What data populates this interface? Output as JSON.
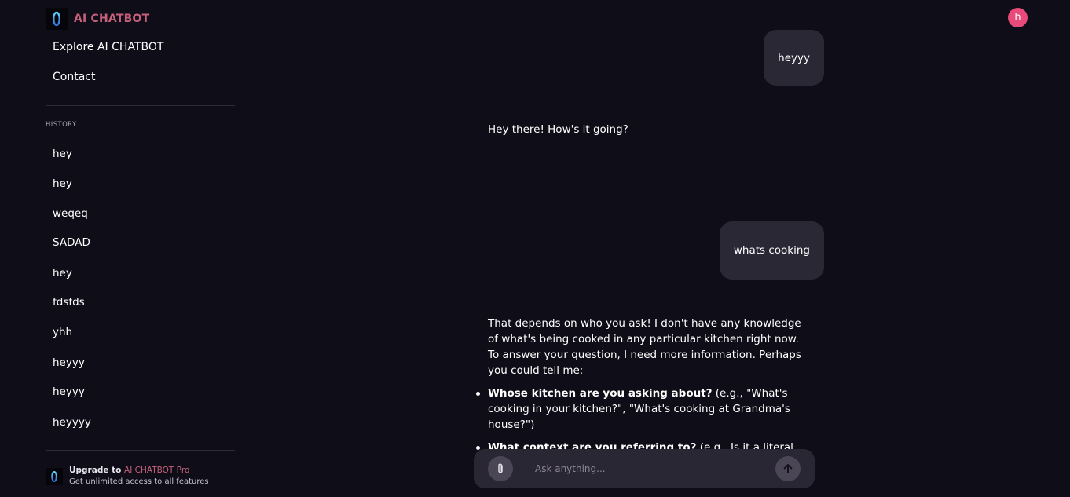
{
  "brand": {
    "name_prefix": "AI",
    "name_suffix": "CHATBOT"
  },
  "nav": {
    "items": [
      {
        "label": "Explore AI CHATBOT"
      },
      {
        "label": "Contact"
      }
    ]
  },
  "history": {
    "label": "HISTORY",
    "items": [
      {
        "label": "hey"
      },
      {
        "label": "hey"
      },
      {
        "label": "weqeq"
      },
      {
        "label": "SADAD"
      },
      {
        "label": "hey"
      },
      {
        "label": "fdsfds"
      },
      {
        "label": "yhh"
      },
      {
        "label": "heyyy"
      },
      {
        "label": "heyyy"
      },
      {
        "label": "heyyyy"
      }
    ]
  },
  "upgrade": {
    "title_prefix": "Upgrade to",
    "title_product": "AI CHATBOT Pro",
    "subtitle": "Get unlimited access to all features"
  },
  "user": {
    "avatar_initial": "h",
    "avatar_color": "#e84a7c"
  },
  "messages": {
    "user_1": "heyyy",
    "bot_1": "Hey there! How's it going?",
    "user_2": "whats cooking",
    "bot_2": {
      "intro": "That depends on who you ask! I don't have any knowledge of what's being cooked in any particular kitchen right now. To answer your question, I need more information. Perhaps you could tell me:",
      "bullets": [
        {
          "bold": "Whose kitchen are you asking about?",
          "text": " (e.g., \"What's cooking in your kitchen?\", \"What's cooking at Grandma's house?\")"
        },
        {
          "bold": "What context are you referring to?",
          "text": " (e.g., Is it a literal question about food, or a figurative question about what's happening?)"
        }
      ]
    }
  },
  "composer": {
    "placeholder": "Ask anything..."
  },
  "colors": {
    "background": "#0f0d17",
    "accent": "#c4607a",
    "bubble": "#2b2836",
    "composer": "#2a2734"
  },
  "icons": {
    "attach": "paperclip-icon",
    "send": "arrow-up-icon",
    "logo": "ai-logo-icon"
  }
}
